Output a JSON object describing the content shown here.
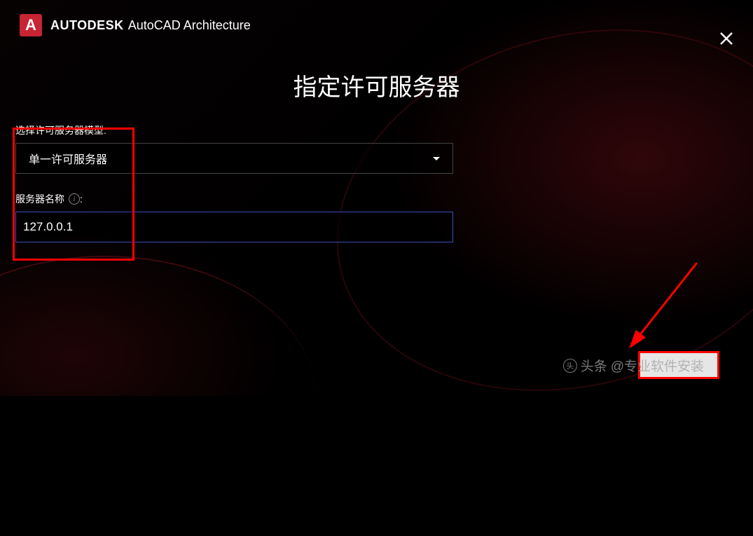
{
  "header": {
    "logo_letter": "A",
    "brand_bold": "AUTODESK",
    "brand_product": "AutoCAD Architecture"
  },
  "page_title": "指定许可服务器",
  "form": {
    "server_model_label": "选择许可服务器模型:",
    "server_model_value": "单一许可服务器",
    "server_name_label": "服务器名称",
    "server_name_value": "127.0.0.1"
  },
  "watermark": {
    "prefix": "头条",
    "text": "@专业软件安装"
  },
  "colors": {
    "accent": "#c72434",
    "highlight": "#ff0000",
    "input_border": "#3b4db8"
  }
}
